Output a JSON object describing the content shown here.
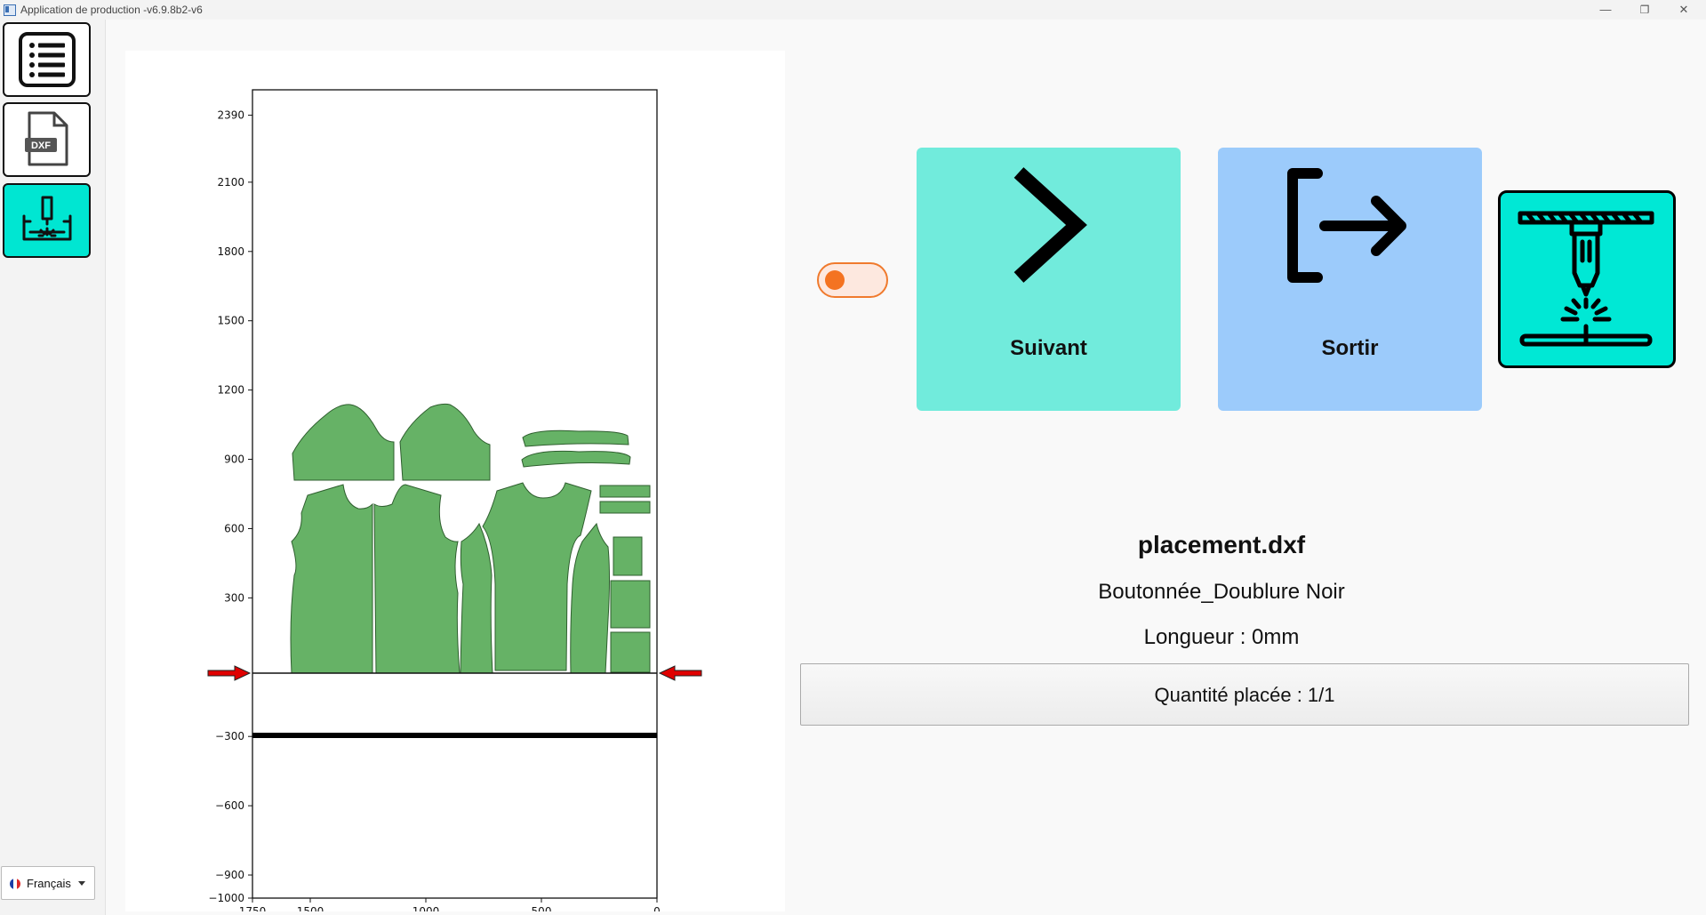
{
  "window": {
    "title": "Application de production -v6.9.8b2-v6",
    "controls": [
      "—",
      "❐",
      "✕"
    ]
  },
  "sidebar": {
    "items": [
      {
        "name": "list-menu",
        "icon": "list-icon"
      },
      {
        "name": "dxf-file",
        "icon": "dxf-file-icon",
        "badge": "DXF"
      },
      {
        "name": "laser-cutter",
        "icon": "laser-cutter-icon",
        "active": true
      }
    ],
    "language": {
      "selected": "Français",
      "flag": "fr-flag-icon"
    }
  },
  "toggle": {
    "on": true,
    "color": "#f47321"
  },
  "buttons": {
    "next": {
      "label": "Suivant",
      "icon": "chevron-right-icon",
      "color": "#71ebdc"
    },
    "exit": {
      "label": "Sortir",
      "icon": "exit-icon",
      "color": "#9ccbfb"
    },
    "laser": {
      "icon": "laser-cutter-icon",
      "color": "#00e8d5"
    }
  },
  "info": {
    "filename": "placement.dxf",
    "material": "Boutonnée_Doublure Noir",
    "length": "Longueur : 0mm",
    "quantity": "Quantité placée : 1/1"
  },
  "chart_data": {
    "type": "nesting-layout",
    "x_ticks": [
      "1750",
      "1500",
      "1000",
      "500",
      "0"
    ],
    "x_range": [
      1750,
      0
    ],
    "y_ticks": [
      "2390",
      "2100",
      "1800",
      "1500",
      "1200",
      "900",
      "600",
      "300",
      "−300",
      "−600",
      "−900",
      "−1000"
    ],
    "y_range": [
      -1000,
      2500
    ],
    "marker_y": 0,
    "cut_line_y": -270,
    "piece_color": "#66b266",
    "marker_color": "#e00000"
  }
}
